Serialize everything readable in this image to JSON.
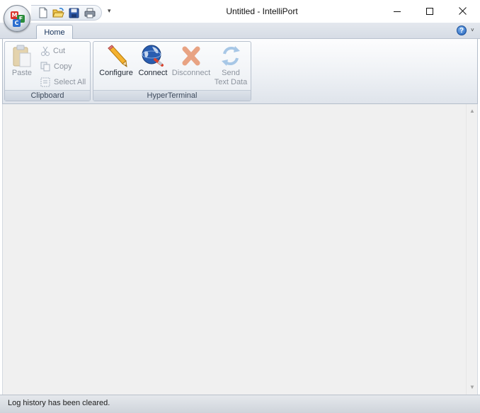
{
  "window": {
    "title": "Untitled - IntelliPort",
    "minimize_icon": "minimize-icon",
    "maximize_icon": "maximize-icon",
    "close_icon": "close-icon"
  },
  "app_button": {
    "icon": "app-logo-icon",
    "letters": [
      "M",
      "F",
      "C"
    ]
  },
  "quick_access": {
    "items": [
      "new-document-icon",
      "open-folder-icon",
      "save-icon",
      "print-icon"
    ],
    "customize_glyph": "▾"
  },
  "ribbon": {
    "tabs": [
      {
        "label": "Home",
        "active": true
      }
    ],
    "help_glyph": "?",
    "help_caret": "˅",
    "groups": {
      "clipboard": {
        "label": "Clipboard",
        "paste": {
          "label": "Paste",
          "enabled": false
        },
        "cut": {
          "label": "Cut",
          "enabled": false
        },
        "copy": {
          "label": "Copy",
          "enabled": false
        },
        "select_all": {
          "label": "Select All",
          "enabled": false
        }
      },
      "hyperterminal": {
        "label": "HyperTerminal",
        "configure": {
          "label": "Configure",
          "enabled": true
        },
        "connect": {
          "label": "Connect",
          "enabled": true
        },
        "disconnect": {
          "label": "Disconnect",
          "enabled": false
        },
        "send": {
          "label_line1": "Send",
          "label_line2": "Text Data",
          "enabled": false
        }
      }
    }
  },
  "scrollbar": {
    "up_glyph": "▲",
    "down_glyph": "▼"
  },
  "status": {
    "text": "Log history has been cleared."
  },
  "colors": {
    "ribbon_border": "#b8c1ce",
    "content_bg": "#f0f0f0",
    "disabled_text": "#8d949e"
  }
}
